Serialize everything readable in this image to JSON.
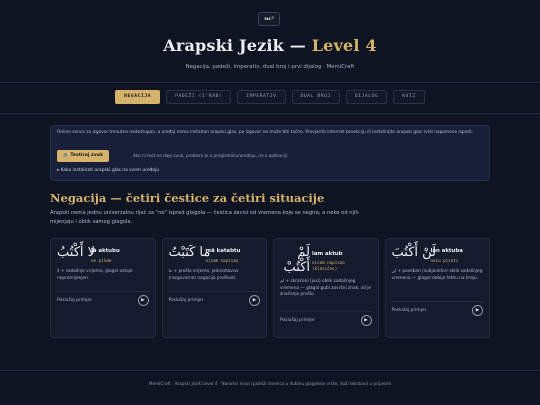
{
  "header": {
    "logo_text": "ᴍᴄ²",
    "title_main": "Arapski Jezik — ",
    "title_level": "Level 4",
    "subtitle": "Negacija, padeži, imperativ, dual broj i prvi dijalog · MemiCraft"
  },
  "tabs": [
    "NEGACIJA",
    "PADEŽI (I'RAB)",
    "IMPERATIV",
    "DUAL BROJ",
    "DIJALOG",
    "KVIZ"
  ],
  "notice": {
    "text": "Online servis za izgovor trenutno nedostupan, a uređaj nema instalran arapski glas, pa izgovor ne može biti tačno. Provjerite internet konekciju ili instalirajte arapski glas (vidi napomene ispod).",
    "test_button": "🔊 Testiraj zvuk",
    "test_note": "Ako ni test ne daje zvuk, problem je u pregledniku/uređaju, ne u aplikaciji.",
    "install_link": "▸ Kako instalirati arapski glas na svom uređaju"
  },
  "section": {
    "title": "Negacija — četiri čestice za četiri situacije",
    "desc": "Arapski nema jednu univerzalnu riječ za \"ne\" ispred glagola — čestica zavisi od vremena koje se negira, a neke od njih mijenjaju i oblik samog glagola."
  },
  "cards": [
    {
      "arabic": "لا أَكْتُبُ",
      "translit": "lā aktubu",
      "phon": "ne pišem",
      "explanation": "لا + sadašnje vrijeme, glagol ostaje nepromijenjen.",
      "example": "Poslušaj primjer"
    },
    {
      "arabic": "ما كَتَبْتُ",
      "translit": "mā katabtu",
      "phon": "nisam napisao",
      "explanation": "ما + prošlo vrijeme, jednostavna (razgovorna) negacija prošlosti.",
      "example": "Poslušaj primjer"
    },
    {
      "arabic": "لَمْ أَكْتُبْ",
      "translit": "lam aktub",
      "phon": "nisam napisao (klasično)",
      "explanation": "لم + skraćeni (jusi) oblik sadašnjeg vremena — glagol gubi završni znak, ali je značenje prošlo.",
      "example": "Poslušaj primjer"
    },
    {
      "arabic": "لَنْ أَكْتُبَ",
      "translit": "lan aktuba",
      "phon": "neću pisati",
      "explanation": "لن + poseban (subjunktiv) oblik sadašnjeg vremena — glagol dobija fethu na kraju.",
      "example": "Poslušaj primjer"
    }
  ],
  "footer": "MemiCraft · Arapski Jezik Level 4 · Nanošni nivoi (padeži imenica u dubinu glagolske vrste, duži tekstovi) u pripremi"
}
